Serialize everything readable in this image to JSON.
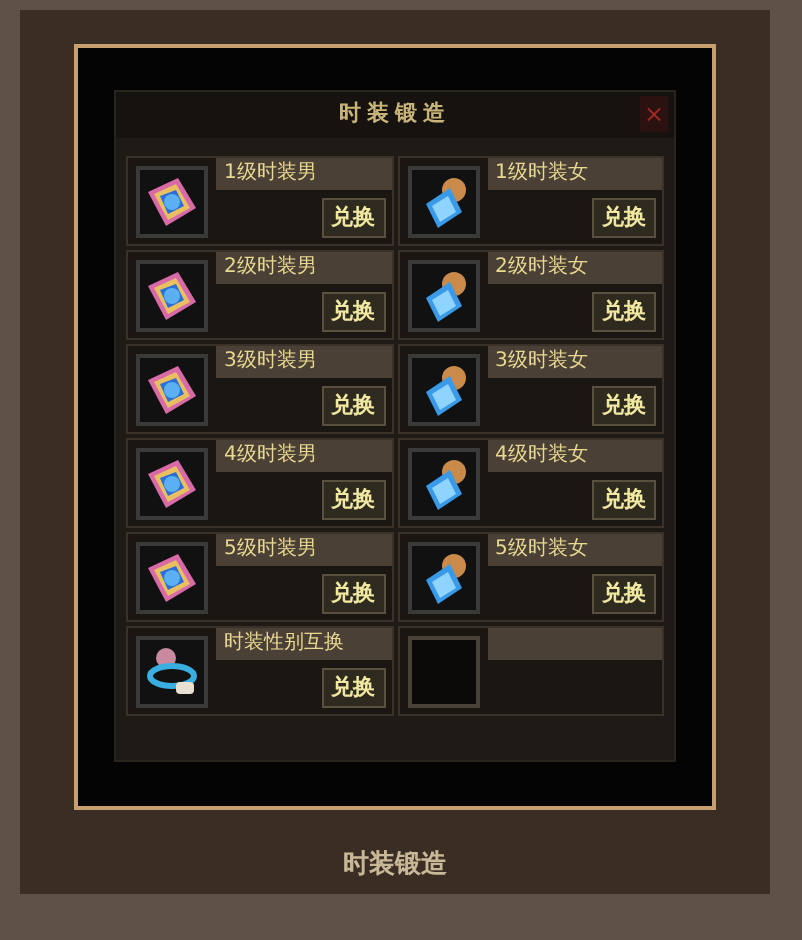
{
  "dialog": {
    "title": "时装锻造",
    "close": "×"
  },
  "slots": [
    {
      "kind": "male",
      "name": "1级时装男",
      "button": "兑换"
    },
    {
      "kind": "female",
      "name": "1级时装女",
      "button": "兑换"
    },
    {
      "kind": "male",
      "name": "2级时装男",
      "button": "兑换"
    },
    {
      "kind": "female",
      "name": "2级时装女",
      "button": "兑换"
    },
    {
      "kind": "male",
      "name": "3级时装男",
      "button": "兑换"
    },
    {
      "kind": "female",
      "name": "3级时装女",
      "button": "兑换"
    },
    {
      "kind": "male",
      "name": "4级时装男",
      "button": "兑换"
    },
    {
      "kind": "female",
      "name": "4级时装女",
      "button": "兑换"
    },
    {
      "kind": "male",
      "name": "5级时装男",
      "button": "兑换"
    },
    {
      "kind": "female",
      "name": "5级时装女",
      "button": "兑换"
    },
    {
      "kind": "swap",
      "name": "时装性别互换",
      "button": "兑换"
    },
    {
      "kind": "empty"
    }
  ],
  "caption": "时装锻造"
}
